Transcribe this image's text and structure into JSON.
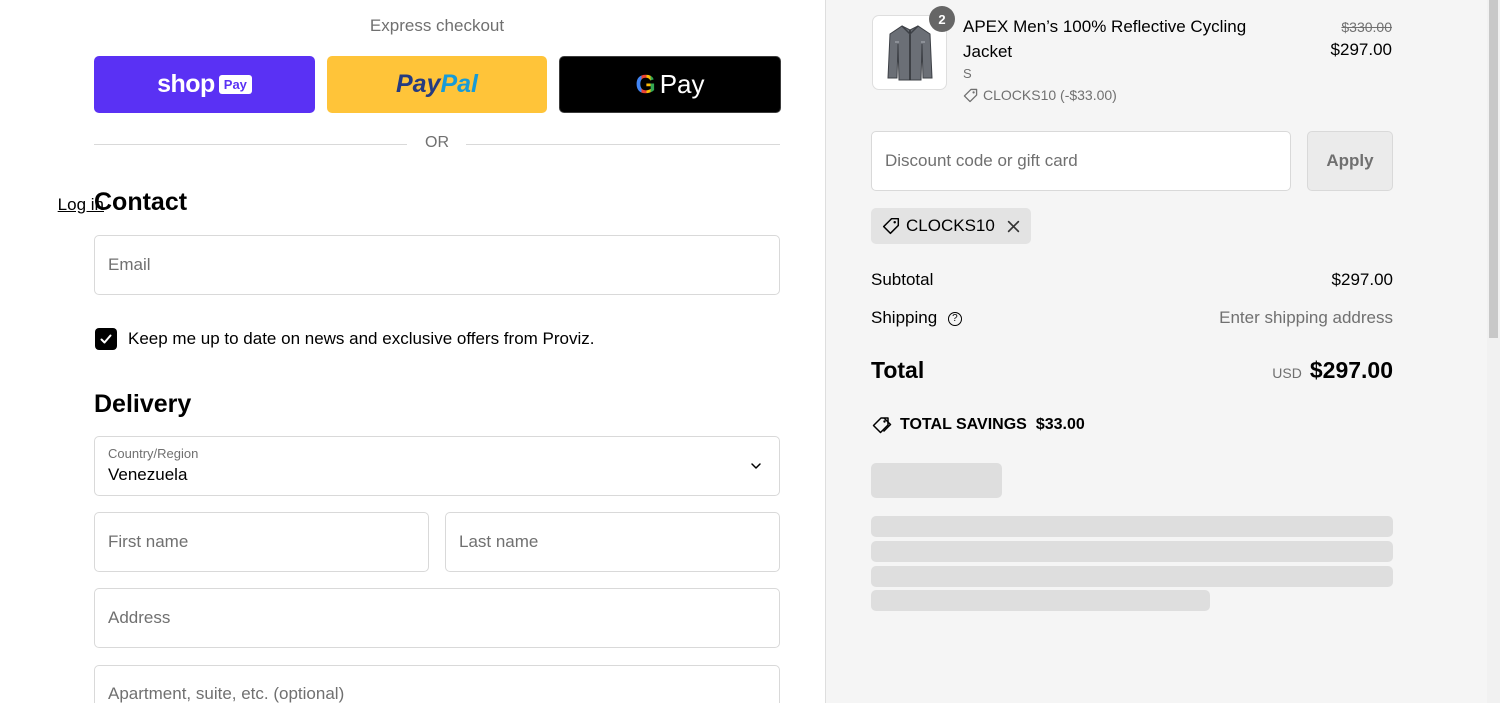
{
  "express_checkout": {
    "title": "Express checkout",
    "shop_pay": {
      "word": "shop",
      "badge": "Pay"
    },
    "paypal": {
      "part1": "Pay",
      "part2": "Pal"
    },
    "gpay": {
      "g": "G",
      "pay": "Pay"
    }
  },
  "divider": {
    "or": "OR"
  },
  "contact": {
    "heading": "Contact",
    "login_link": "Log in",
    "email_placeholder": "Email",
    "newsletter_label": "Keep me up to date on news and exclusive offers from Proviz.",
    "newsletter_checked": true
  },
  "delivery": {
    "heading": "Delivery",
    "country_label": "Country/Region",
    "country_value": "Venezuela",
    "first_name_placeholder": "First name",
    "last_name_placeholder": "Last name",
    "address_placeholder": "Address",
    "apartment_placeholder": "Apartment, suite, etc. (optional)"
  },
  "cart": {
    "item": {
      "quantity": "2",
      "name": "APEX Men’s 100% Reflective Cycling Jacket",
      "variant": "S",
      "discount_line": "CLOCKS10 (-$33.00)",
      "original_price": "$330.00",
      "price": "$297.00",
      "image_icon": "jacket-thumbnail"
    },
    "discount_placeholder": "Discount code or gift card",
    "apply_label": "Apply",
    "applied_code": "CLOCKS10",
    "subtotal_label": "Subtotal",
    "subtotal_value": "$297.00",
    "shipping_label": "Shipping",
    "shipping_value": "Enter shipping address",
    "total_label": "Total",
    "currency": "USD",
    "total_value": "$297.00",
    "savings_label": "TOTAL SAVINGS",
    "savings_value": "$33.00"
  },
  "colors": {
    "shop_pay": "#5a31f4",
    "paypal": "#ffc439",
    "gpay": "#000000",
    "sidebar_bg": "#f5f5f5"
  }
}
